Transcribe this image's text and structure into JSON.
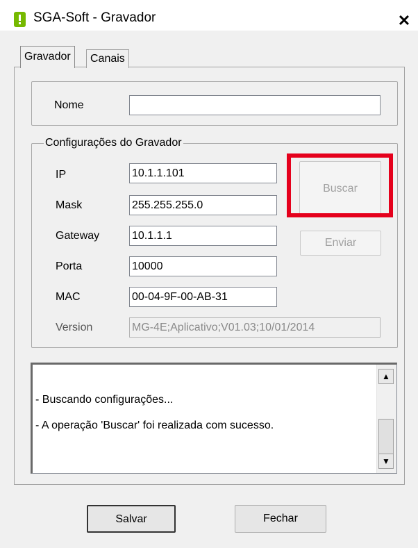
{
  "window": {
    "title": "SGA-Soft - Gravador",
    "close_label": "✕"
  },
  "tabs": [
    {
      "label": "Gravador",
      "active": true
    },
    {
      "label": "Canais",
      "active": false
    }
  ],
  "nome": {
    "label": "Nome",
    "value": ""
  },
  "config": {
    "legend": "Configurações do Gravador",
    "fields": [
      {
        "label": "IP",
        "value": "10.1.1.101"
      },
      {
        "label": "Mask",
        "value": "255.255.255.0"
      },
      {
        "label": "Gateway",
        "value": "10.1.1.1"
      },
      {
        "label": "Porta",
        "value": "10000"
      },
      {
        "label": "MAC",
        "value": "00-04-9F-00-AB-31"
      },
      {
        "label": "Version",
        "value": "MG-4E;Aplicativo;V01.03;10/01/2014"
      }
    ],
    "buscar_label": "Buscar",
    "enviar_label": "Enviar"
  },
  "log": {
    "lines": [
      "- Buscando configurações...",
      "- A operação 'Buscar' foi realizada com sucesso."
    ]
  },
  "footer": {
    "salvar_label": "Salvar",
    "fechar_label": "Fechar"
  },
  "colors": {
    "highlight": "#e5001c",
    "app_icon": "#76b900"
  },
  "icons": {
    "app": "app-warning-icon",
    "close": "close-icon",
    "scroll_up": "up-arrow-icon",
    "scroll_down": "down-arrow-icon"
  }
}
